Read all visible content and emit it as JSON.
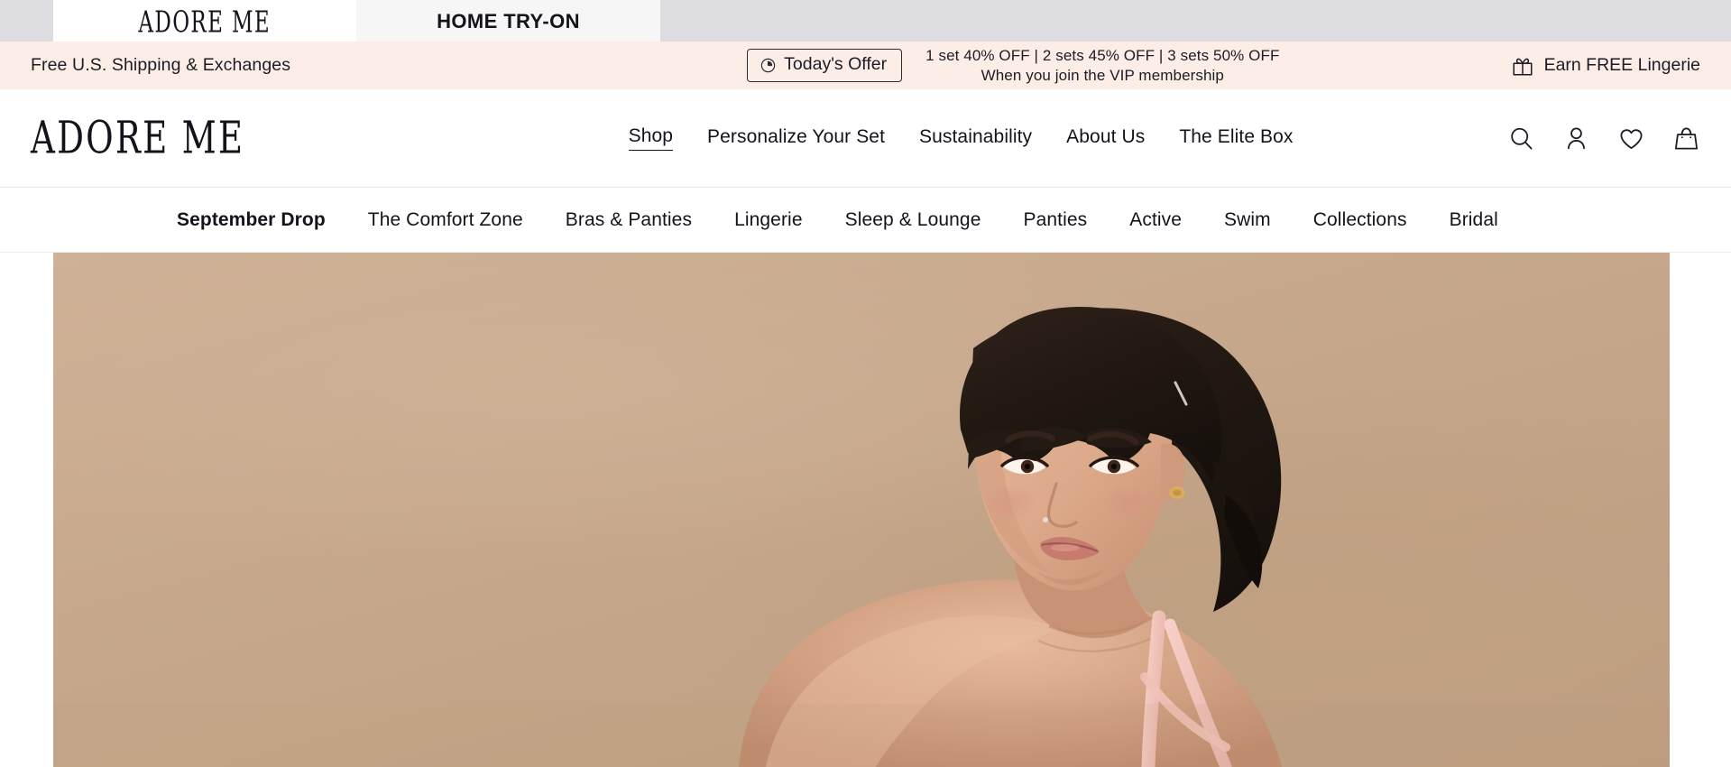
{
  "top_strip": {
    "panels": [
      {
        "name": "brand-panel",
        "label": "ADORE ME"
      },
      {
        "name": "home-tryon-panel",
        "label": "HOME TRY-ON"
      }
    ]
  },
  "promo": {
    "left_text": "Free U.S. Shipping & Exchanges",
    "offer_button_label": "Today's Offer",
    "offer_icon": "clock-icon",
    "line_1": "1 set 40% OFF | 2 sets 45% OFF | 3 sets 50% OFF",
    "line_2": "When you join the VIP membership",
    "right_text": "Earn FREE Lingerie",
    "right_icon": "gift-icon",
    "background_color": "#fceee7"
  },
  "header": {
    "logo": "ADORE ME",
    "nav": [
      {
        "label": "Shop",
        "active": true
      },
      {
        "label": "Personalize Your Set",
        "active": false
      },
      {
        "label": "Sustainability",
        "active": false
      },
      {
        "label": "About Us",
        "active": false
      },
      {
        "label": "The Elite Box",
        "active": false
      }
    ],
    "icons": [
      {
        "name": "search-icon",
        "label": "Search"
      },
      {
        "name": "account-icon",
        "label": "Account"
      },
      {
        "name": "wishlist-heart-icon",
        "label": "Wishlist"
      },
      {
        "name": "shopping-bag-icon",
        "label": "Bag"
      }
    ]
  },
  "category_nav": {
    "items": [
      {
        "label": "September Drop",
        "bold": true
      },
      {
        "label": "The Comfort Zone",
        "bold": false
      },
      {
        "label": "Bras & Panties",
        "bold": false
      },
      {
        "label": "Lingerie",
        "bold": false
      },
      {
        "label": "Sleep & Lounge",
        "bold": false
      },
      {
        "label": "Panties",
        "bold": false
      },
      {
        "label": "Active",
        "bold": false
      },
      {
        "label": "Swim",
        "bold": false
      },
      {
        "label": "Collections",
        "bold": false
      },
      {
        "label": "Bridal",
        "bold": false
      }
    ]
  },
  "hero": {
    "alt": "Model with short dark hair looking over shoulder wearing pink lingerie strap",
    "background_color": "#c9ab8f"
  }
}
